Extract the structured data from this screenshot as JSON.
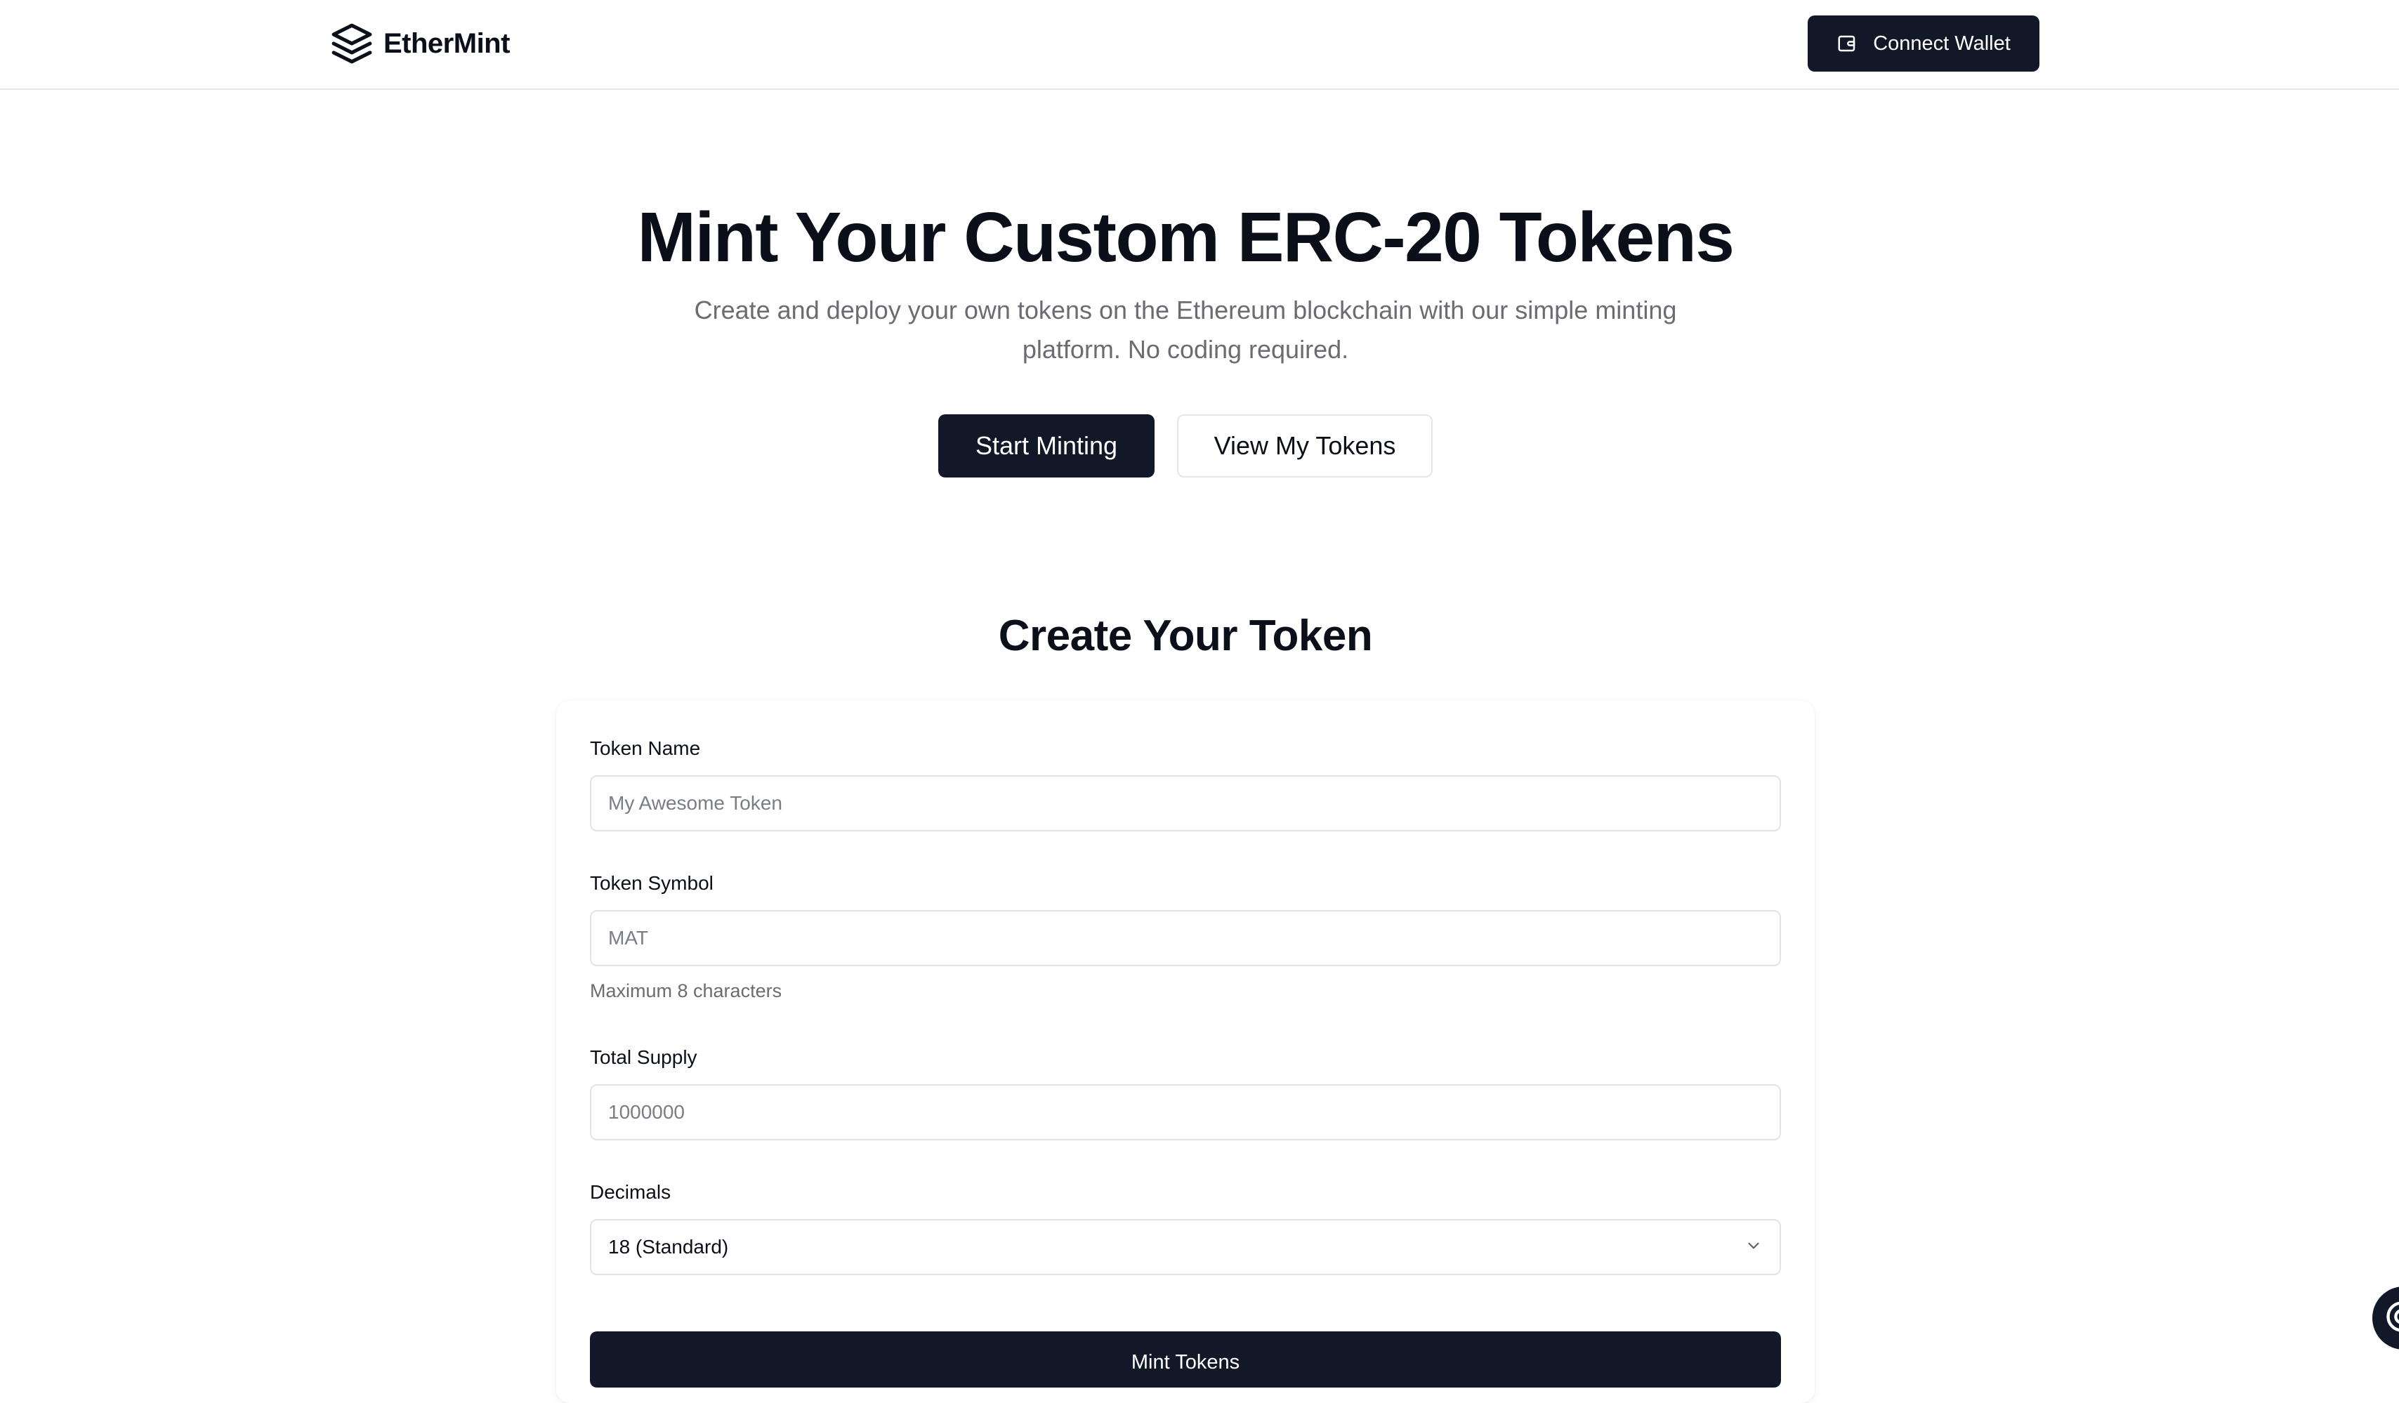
{
  "header": {
    "brand": "EtherMint",
    "connect_wallet_label": "Connect Wallet"
  },
  "hero": {
    "title": "Mint Your Custom ERC-20 Tokens",
    "subtitle": "Create and deploy your own tokens on the Ethereum blockchain with our simple minting platform. No coding required.",
    "primary_button": "Start Minting",
    "secondary_button": "View My Tokens"
  },
  "form": {
    "title": "Create Your Token",
    "token_name": {
      "label": "Token Name",
      "placeholder": "My Awesome Token",
      "value": ""
    },
    "token_symbol": {
      "label": "Token Symbol",
      "placeholder": "MAT",
      "value": "",
      "hint": "Maximum 8 characters"
    },
    "total_supply": {
      "label": "Total Supply",
      "placeholder": "1000000",
      "value": ""
    },
    "decimals": {
      "label": "Decimals",
      "selected": "18 (Standard)"
    },
    "submit_label": "Mint Tokens"
  },
  "icons": {
    "logo": "layers-icon",
    "wallet": "wallet-icon",
    "select_chevron": "chevron-down-icon",
    "help": "help-icon"
  },
  "colors": {
    "primary": "#111827",
    "text": "#0b0f19",
    "muted": "#6b6b73",
    "border": "#e2e4e8",
    "background": "#ffffff"
  }
}
